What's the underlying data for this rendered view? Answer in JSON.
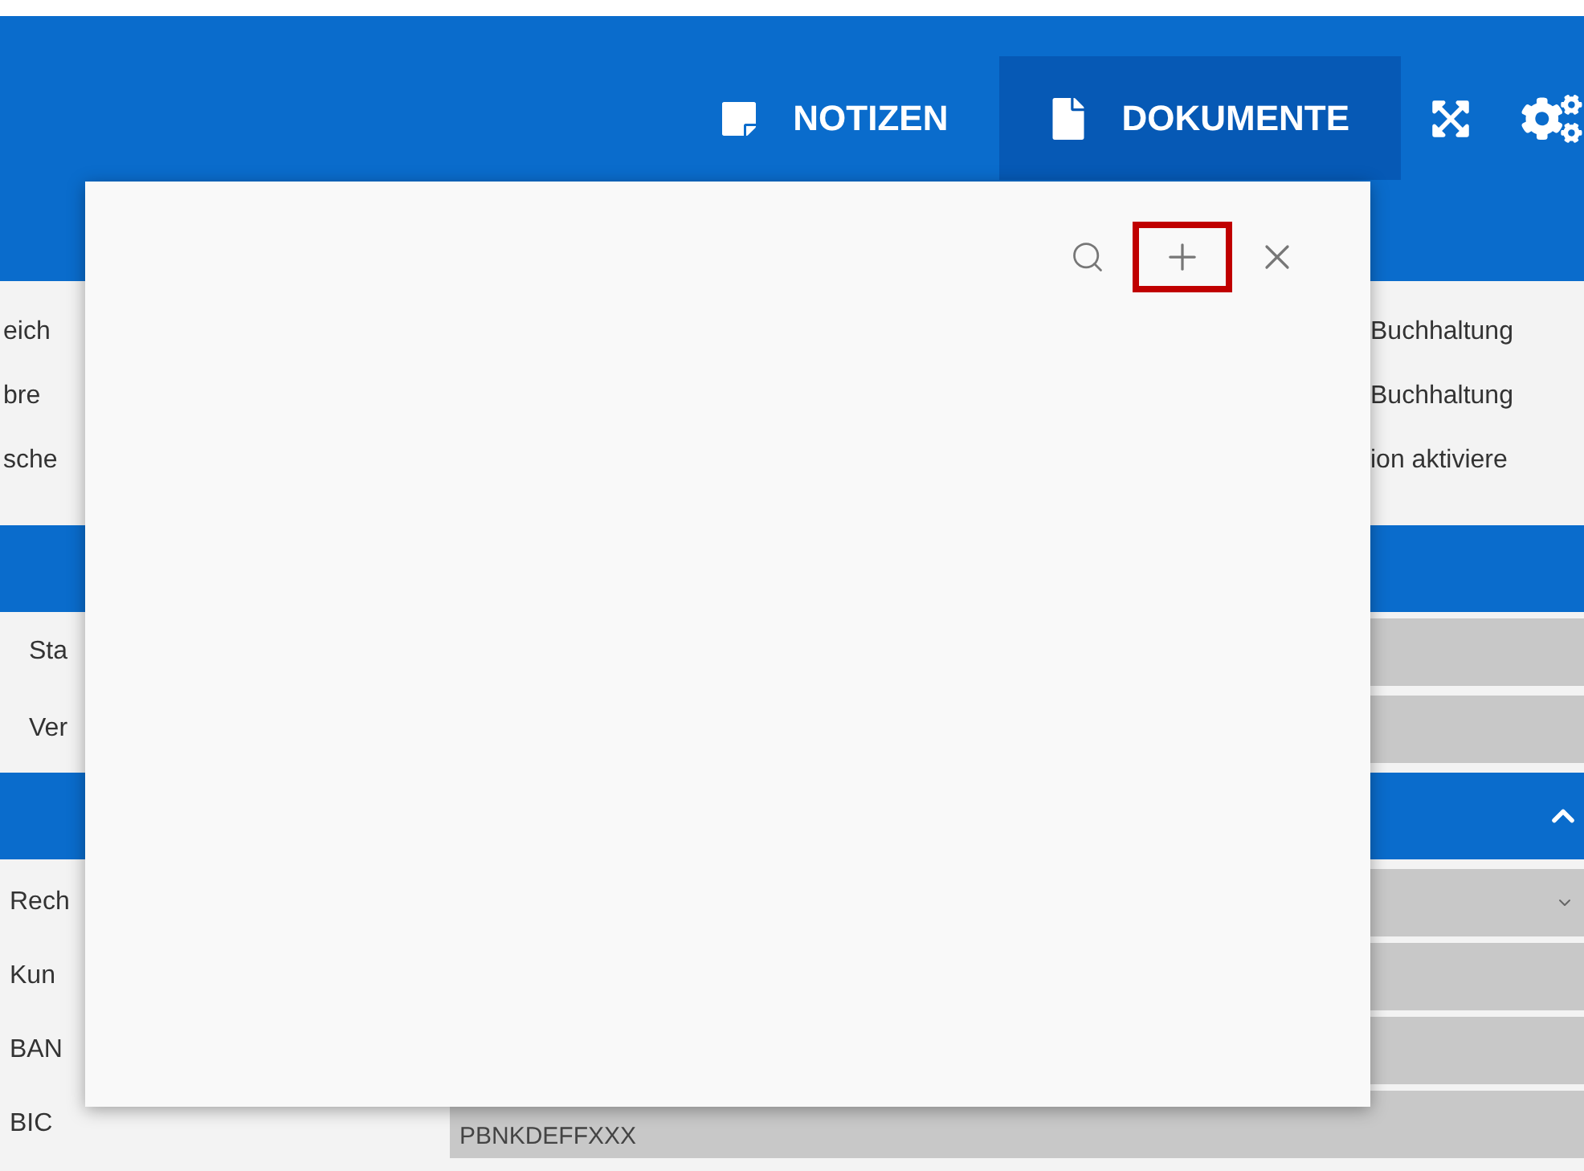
{
  "header": {
    "tabs": [
      {
        "label": "NOTIZEN",
        "selected": false
      },
      {
        "label": "DOKUMENTE",
        "selected": true
      }
    ]
  },
  "settings_lines": [
    {
      "left": "eich",
      "right": "Buchhaltung"
    },
    {
      "left": "bre",
      "right": "Buchhaltung"
    },
    {
      "left": "sche",
      "right": "ion aktiviere"
    }
  ],
  "section_1": {
    "fields": [
      {
        "label": "Sta",
        "kind": "input"
      },
      {
        "label": "Ver",
        "kind": "input"
      }
    ]
  },
  "section_2": {
    "expanded": true,
    "fields": [
      {
        "label": "Rech",
        "kind": "select"
      },
      {
        "label": "Kun",
        "kind": "input"
      },
      {
        "label": "BAN",
        "kind": "input"
      },
      {
        "label": "BIC",
        "kind": "input",
        "value": "PBNKDEFFXXX"
      }
    ]
  },
  "popup": {
    "actions": [
      {
        "kind": "search",
        "highlighted": false
      },
      {
        "kind": "add",
        "highlighted": true
      },
      {
        "kind": "close",
        "highlighted": false
      }
    ]
  }
}
